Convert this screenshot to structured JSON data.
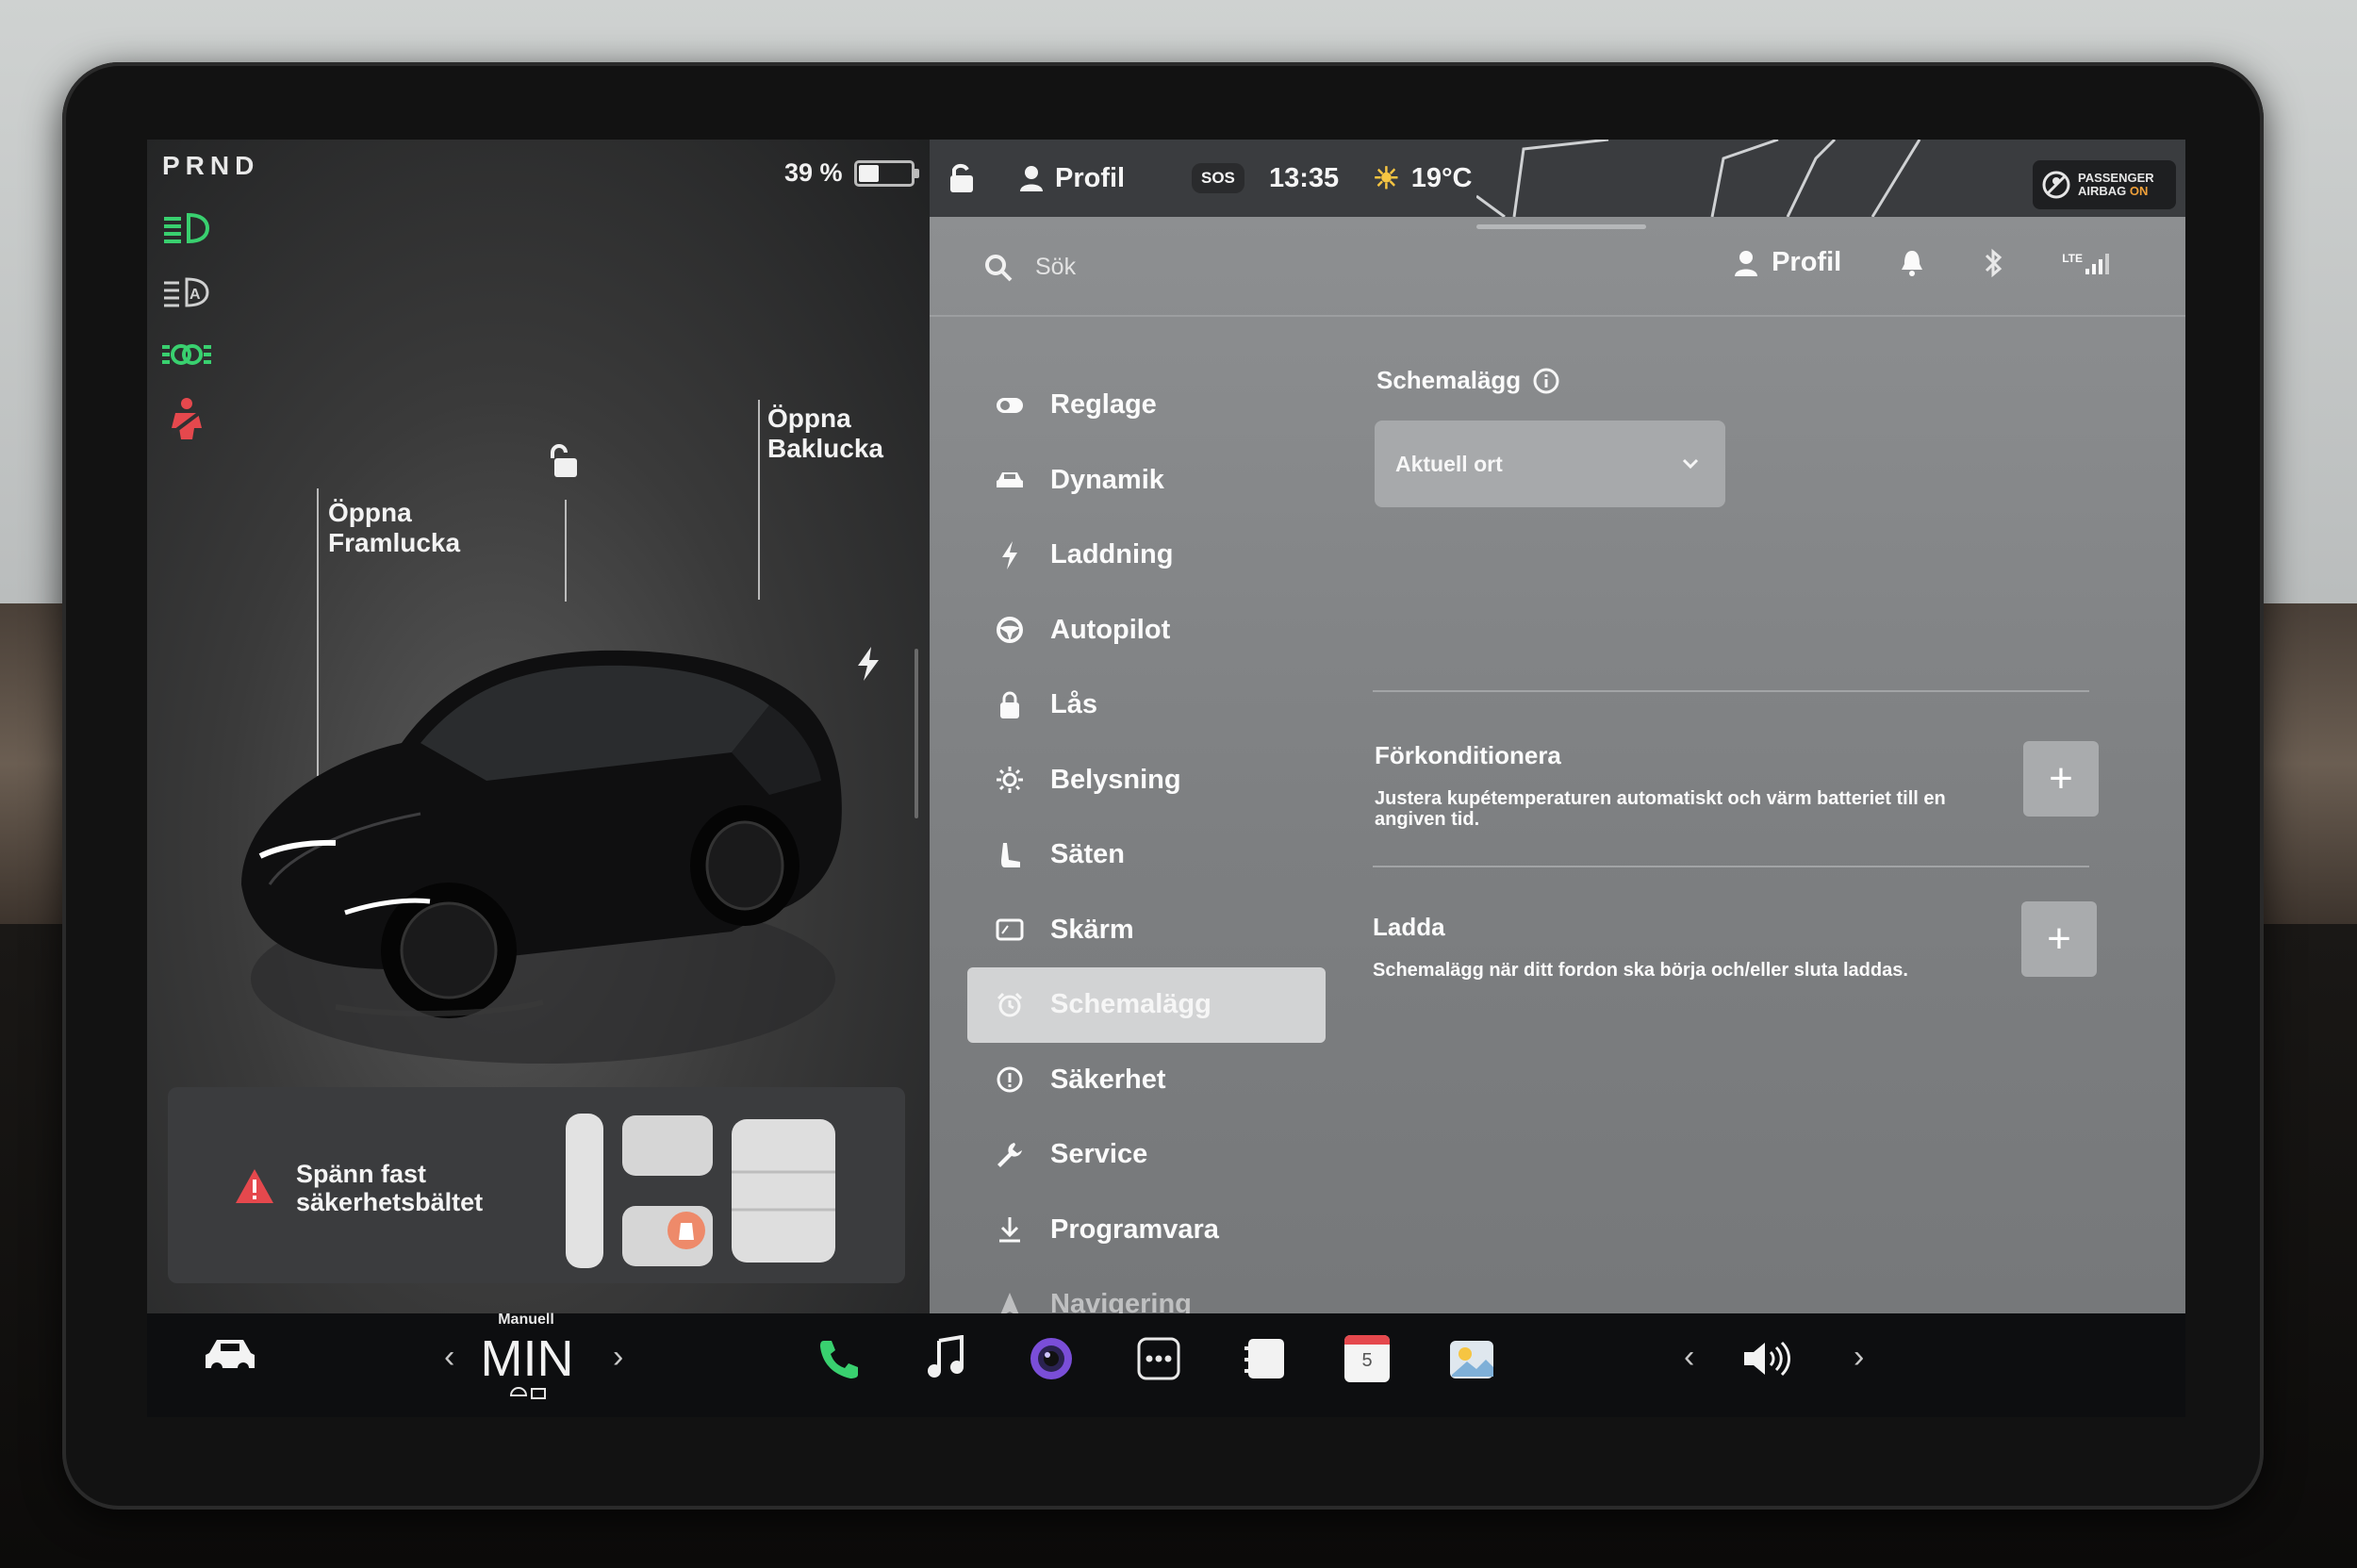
{
  "gear": "PRND",
  "battery": {
    "label": "39 %",
    "level": 0.39
  },
  "callouts": {
    "front": [
      "Öppna",
      "Framlucka"
    ],
    "rear": [
      "Öppna",
      "Baklucka"
    ]
  },
  "alert": {
    "lines": [
      "Spänn fast",
      "säkerhetsbältet"
    ]
  },
  "statusbar": {
    "profile": "Profil",
    "sos": "SOS",
    "time": "13:35",
    "temp": "19°C",
    "airbag_line1": "PASSENGER",
    "airbag_line2": "AIRBAG",
    "airbag_state": "ON"
  },
  "search": {
    "placeholder": "Sök"
  },
  "top_right": {
    "profile": "Profil",
    "lte": "LTE"
  },
  "menu": [
    {
      "label": "Reglage",
      "icon": "toggle-icon"
    },
    {
      "label": "Dynamik",
      "icon": "car-icon"
    },
    {
      "label": "Laddning",
      "icon": "bolt-icon"
    },
    {
      "label": "Autopilot",
      "icon": "steering-wheel-icon"
    },
    {
      "label": "Lås",
      "icon": "lock-icon"
    },
    {
      "label": "Belysning",
      "icon": "sun-icon"
    },
    {
      "label": "Säten",
      "icon": "seat-icon"
    },
    {
      "label": "Skärm",
      "icon": "display-icon"
    },
    {
      "label": "Schemalägg",
      "icon": "alarm-clock-icon",
      "active": true
    },
    {
      "label": "Säkerhet",
      "icon": "alert-circle-icon"
    },
    {
      "label": "Service",
      "icon": "wrench-icon"
    },
    {
      "label": "Programvara",
      "icon": "download-icon"
    },
    {
      "label": "Navigering",
      "icon": "navigation-icon"
    }
  ],
  "schedule": {
    "title": "Schemalägg",
    "dropdown_value": "Aktuell ort",
    "precondition_title": "Förkonditionera",
    "precondition_desc": [
      "Justera kupétemperaturen automatiskt och värm batteriet till en",
      "angiven tid."
    ],
    "charge_title": "Ladda",
    "charge_desc": "Schemalägg när ditt fordon ska börja och/eller sluta laddas.",
    "add_symbol": "+"
  },
  "bottombar": {
    "climate_mode": "Manuell",
    "climate_value": "MIN",
    "calendar_day": "5"
  },
  "colors": {
    "accent_green": "#39d06f",
    "alert_red": "#e5484d",
    "active_menu": "#d2d3d4"
  }
}
